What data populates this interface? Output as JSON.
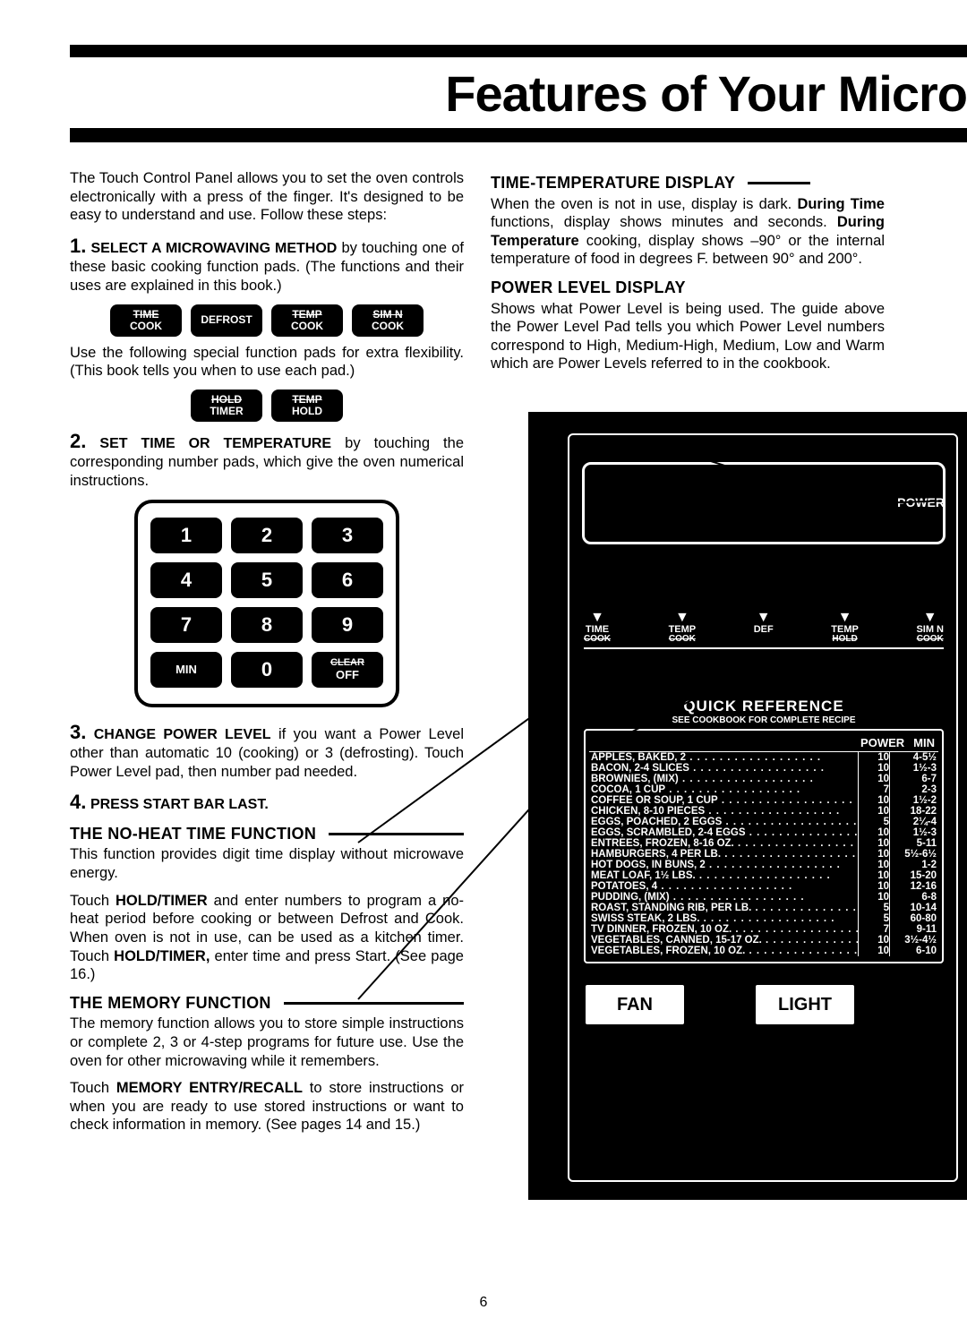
{
  "title": "Features of Your Micro",
  "intro": "The Touch Control Panel allows you to set the oven controls electronically with a press of the finger. It's designed to be easy to understand and use. Follow these steps:",
  "steps": {
    "s1": {
      "num": "1.",
      "head": "SELECT A MICROWAVING METHOD",
      "tail": " by touching one of these basic cooking function pads. (The functions and their uses are explained in this book.)"
    },
    "pads1": [
      {
        "l1": "TIME",
        "l2": "COOK"
      },
      {
        "l1": "DEFROST",
        "l2": ""
      },
      {
        "l1": "TEMP",
        "l2": "COOK"
      },
      {
        "l1": "SIM N",
        "l2": "COOK"
      }
    ],
    "pads1_note": "Use the following special function pads for extra flexibility. (This book tells you when to use each pad.)",
    "pads2": [
      {
        "l1": "HOLD",
        "l2": "TIMER"
      },
      {
        "l1": "TEMP",
        "l2": "HOLD"
      }
    ],
    "s2": {
      "num": "2.",
      "head": "SET TIME OR TEMPERATURE",
      "tail": " by touching the corresponding number pads, which give the oven numerical instructions."
    },
    "numpad": [
      "1",
      "2",
      "3",
      "4",
      "5",
      "6",
      "7",
      "8",
      "9",
      "MIN",
      "0",
      "CLEAR|OFF"
    ],
    "s3": {
      "num": "3.",
      "head": "CHANGE POWER LEVEL",
      "tail": " if you want a Power Level other than automatic 10 (cooking) or 3 (defrosting). Touch Power Level pad, then number pad needed."
    },
    "s4": {
      "num": "4.",
      "head": "PRESS START BAR LAST."
    }
  },
  "noheat": {
    "title": "THE NO-HEAT TIME FUNCTION",
    "p1": "This function provides digit time display without microwave energy.",
    "p2a": "Touch ",
    "p2b": "HOLD/TIMER",
    "p2c": " and enter numbers to program a no-heat period before cooking or between Defrost and Cook. When oven is not in use, can be used as a kitchen timer. Touch ",
    "p2d": "HOLD/TIMER,",
    "p2e": " enter time and press Start. (See page 16.)"
  },
  "memory": {
    "title": "THE MEMORY FUNCTION",
    "p1": "The memory function allows you to store simple instructions or complete 2, 3 or 4-step programs for future use. Use the oven for other microwaving while it remembers.",
    "p2a": "Touch ",
    "p2b": "MEMORY ENTRY/RECALL",
    "p2c": " to store instructions or when you are ready to use stored instructions or want to check information in memory. (See pages 14 and 15.)"
  },
  "ttd": {
    "title": "TIME-TEMPERATURE DISPLAY",
    "p1a": "When the oven is not in use, display is dark. ",
    "p1b": "During Time",
    "p1c": " functions, display shows minutes and seconds. ",
    "p1d": "During Temperature",
    "p1e": " cooking, display shows –90° or the internal temperature of food in degrees F. between 90° and 200°."
  },
  "pld": {
    "title": "POWER LEVEL DISPLAY",
    "p1": "Shows what Power Level is being used. The guide above the Power Level Pad tells you which Power Level numbers correspond to High, Medium-High, Medium, Low and Warm which are Power Levels referred to in the cookbook."
  },
  "panel": {
    "power_label": "POWER",
    "arrows": [
      {
        "t": "TIME",
        "b": "COOK"
      },
      {
        "t": "TEMP",
        "b": "COOK"
      },
      {
        "t": "DEF",
        "b": ""
      },
      {
        "t": "TEMP",
        "b": "HOLD"
      },
      {
        "t": "SIM N",
        "b": "COOK"
      }
    ],
    "qr_title": "QUICK REFERENCE",
    "qr_sub": "SEE COOKBOOK FOR COMPLETE RECIPE",
    "qr_headers": {
      "p": "POWER",
      "m": "MIN"
    },
    "qr_rows": [
      {
        "n": "APPLES, BAKED, 2",
        "p": "10",
        "m": "4-5½"
      },
      {
        "n": "BACON, 2-4 SLICES",
        "p": "10",
        "m": "1½-3"
      },
      {
        "n": "BROWNIES, (MIX)",
        "p": "10",
        "m": "6-7"
      },
      {
        "n": "COCOA, 1 CUP",
        "p": "7",
        "m": "2-3"
      },
      {
        "n": "COFFEE OR SOUP, 1 CUP",
        "p": "10",
        "m": "1½-2"
      },
      {
        "n": "CHICKEN, 8-10 PIECES",
        "p": "10",
        "m": "18-22"
      },
      {
        "n": "EGGS, POACHED, 2 EGGS",
        "p": "5",
        "m": "2¼-4"
      },
      {
        "n": "EGGS, SCRAMBLED, 2-4 EGGS",
        "p": "10",
        "m": "1½-3"
      },
      {
        "n": "ENTREES, FROZEN, 8-16 OZ.",
        "p": "10",
        "m": "5-11"
      },
      {
        "n": "HAMBURGERS, 4 PER LB.",
        "p": "10",
        "m": "5½-6½"
      },
      {
        "n": "HOT DOGS, IN BUNS, 2",
        "p": "10",
        "m": "1-2"
      },
      {
        "n": "MEAT LOAF, 1½ LBS.",
        "p": "10",
        "m": "15-20"
      },
      {
        "n": "POTATOES, 4",
        "p": "10",
        "m": "12-16"
      },
      {
        "n": "PUDDING, (MIX)",
        "p": "10",
        "m": "6-8"
      },
      {
        "n": "ROAST, STANDING RIB, PER LB.",
        "p": "5",
        "m": "10-14"
      },
      {
        "n": "SWISS STEAK, 2 LBS.",
        "p": "5",
        "m": "60-80"
      },
      {
        "n": "TV DINNER, FROZEN, 10 OZ.",
        "p": "7",
        "m": "9-11"
      },
      {
        "n": "VEGETABLES, CANNED, 15-17 OZ.",
        "p": "10",
        "m": "3½-4½"
      },
      {
        "n": "VEGETABLES, FROZEN, 10 OZ.",
        "p": "10",
        "m": "6-10"
      }
    ],
    "fan": "FAN",
    "light": "LIGHT"
  },
  "pagenum": "6"
}
